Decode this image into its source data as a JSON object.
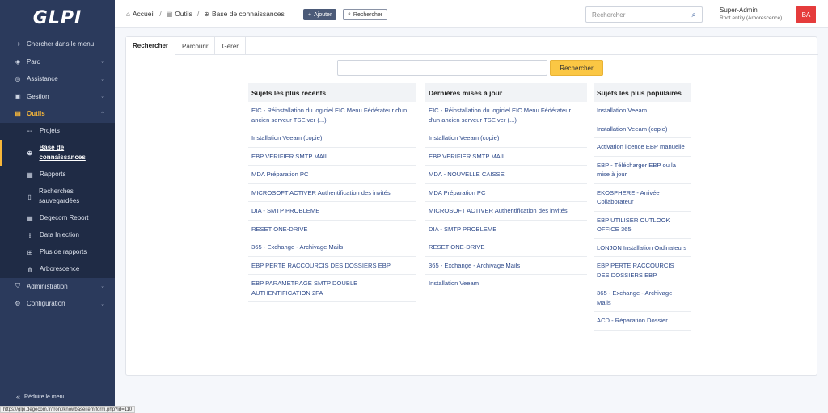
{
  "app": {
    "logo": "GLPI"
  },
  "sidebar": {
    "items": [
      {
        "label": "Chercher dans le menu",
        "icon": "arrow-right-icon"
      },
      {
        "label": "Parc",
        "icon": "cube-icon"
      },
      {
        "label": "Assistance",
        "icon": "headset-icon"
      },
      {
        "label": "Gestion",
        "icon": "wallet-icon"
      },
      {
        "label": "Outils",
        "icon": "briefcase-icon"
      },
      {
        "label": "Administration",
        "icon": "shield-icon"
      },
      {
        "label": "Configuration",
        "icon": "gear-icon"
      }
    ],
    "subitems": [
      {
        "label": "Projets",
        "icon": "project-icon"
      },
      {
        "label": "Base de connaissances",
        "icon": "knowledge-icon"
      },
      {
        "label": "Rapports",
        "icon": "report-icon"
      },
      {
        "label": "Recherches sauvegardées",
        "icon": "bookmark-icon"
      },
      {
        "label": "Degecom Report",
        "icon": "report-icon"
      },
      {
        "label": "Data Injection",
        "icon": "upload-icon"
      },
      {
        "label": "Plus de rapports",
        "icon": "plus-icon"
      },
      {
        "label": "Arborescence",
        "icon": "tree-icon"
      }
    ],
    "collapse_label": "Réduire le menu"
  },
  "header": {
    "breadcrumb": [
      "Accueil",
      "Outils",
      "Base de connaissances"
    ],
    "add_label": "Ajouter",
    "search_label": "Rechercher",
    "global_search_placeholder": "Rechercher",
    "user_name": "Super-Admin",
    "user_entity": "Root entity (Arborescence)",
    "avatar_initials": "BA"
  },
  "main": {
    "tabs": [
      "Rechercher",
      "Parcourir",
      "Gérer"
    ],
    "search_value": "",
    "search_button": "Rechercher",
    "columns": [
      {
        "title": "Sujets les plus récents",
        "items": [
          "EIC - Réinstallation du logiciel EIC Menu Fédérateur d'un ancien serveur TSE ver (...)",
          "Installation Veeam (copie)",
          "EBP VERIFIER SMTP MAIL",
          "MDA Préparation PC",
          "MICROSOFT ACTIVER Authentification des invités",
          "DIA - SMTP PROBLEME",
          "RESET ONE-DRIVE",
          "365 - Exchange - Archivage Mails",
          "EBP PERTE RACCOURCIS DES DOSSIERS EBP",
          "EBP PARAMETRAGE SMTP DOUBLE AUTHENTIFICATION 2FA"
        ]
      },
      {
        "title": "Dernières mises à jour",
        "items": [
          "EIC - Réinstallation du logiciel EIC Menu Fédérateur d'un ancien serveur TSE ver (...)",
          "Installation Veeam (copie)",
          "EBP VERIFIER SMTP MAIL",
          "MDA - NOUVELLE CAISSE",
          "MDA Préparation PC",
          "MICROSOFT ACTIVER Authentification des invités",
          "DIA - SMTP PROBLEME",
          "RESET ONE-DRIVE",
          "365 - Exchange - Archivage Mails",
          "Installation Veeam"
        ]
      },
      {
        "title": "Sujets les plus populaires",
        "items": [
          "Installation Veeam",
          "Installation Veeam (copie)",
          "Activation licence EBP manuelle",
          "EBP - Télécharger EBP ou la mise à jour",
          "EKOSPHERE - Arrivée Collaborateur",
          "EBP UTILISER OUTLOOK OFFICE 365",
          "LONJON Installation Ordinateurs",
          "EBP PERTE RACCOURCIS DES DOSSIERS EBP",
          "365 - Exchange - Archivage Mails",
          "ACD - Réparation Dossier"
        ]
      }
    ]
  },
  "status_url": "https://glpi.degecom.fr/front/knowbaseitem.form.php?id=110",
  "colors": {
    "sidebar": "#2b3a5c",
    "accent": "#f8b739",
    "link": "#2e4a8a",
    "avatar": "#e53c3c"
  }
}
